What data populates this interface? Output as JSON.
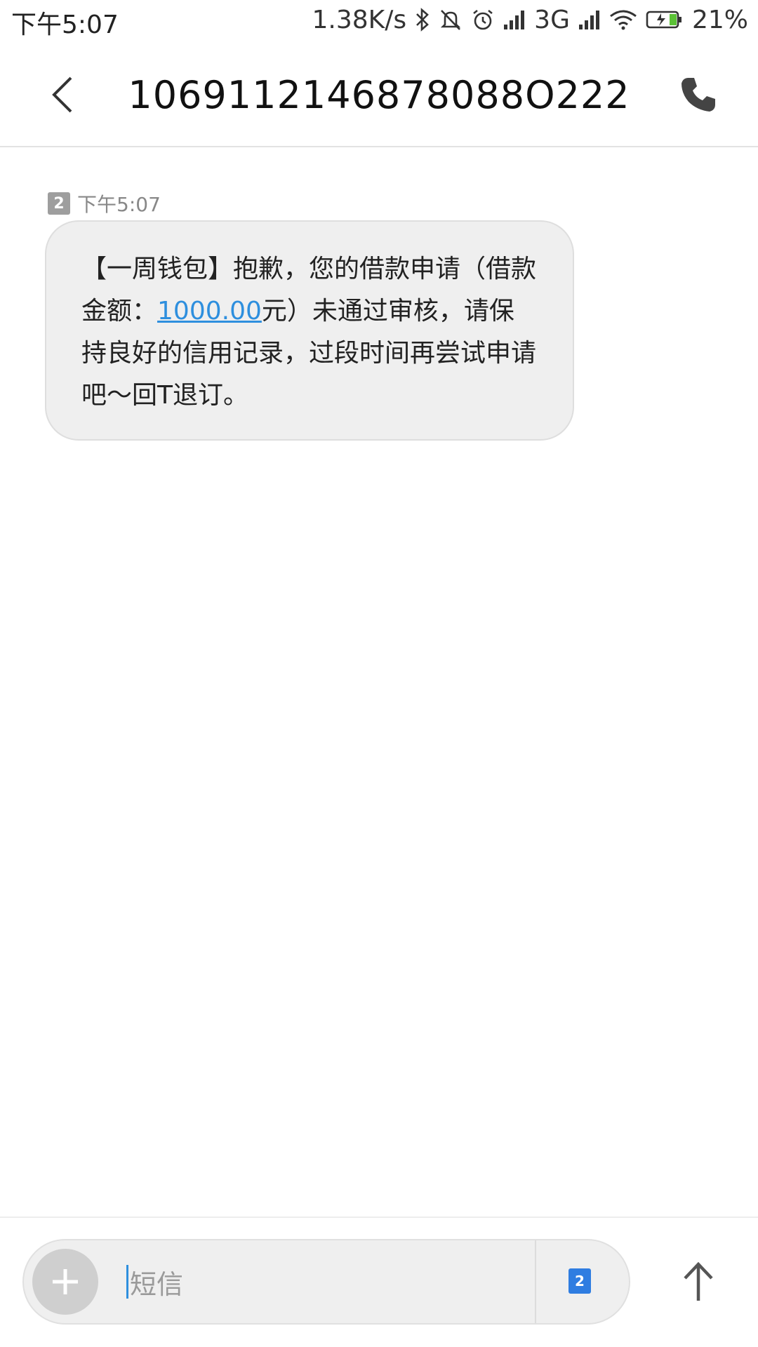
{
  "status_bar": {
    "time": "下午5:07",
    "net_speed": "1.38K/s",
    "network_type": "3G",
    "battery": "21%",
    "icons": [
      "bluetooth-icon",
      "mute-bell-icon",
      "alarm-icon",
      "signal-icon",
      "wifi-icon",
      "battery-charging-icon"
    ]
  },
  "header": {
    "title": "1069112146878088O222",
    "back_icon": "chevron-left-icon",
    "call_icon": "phone-icon"
  },
  "message": {
    "sim": "2",
    "time": "下午5:07",
    "text_before": "【一周钱包】抱歉，您的借款申请（借款金额：",
    "amount": "1000.00",
    "text_after": "元）未通过审核，请保持良好的信用记录，过段时间再尝试申请吧～回T退订。"
  },
  "composer": {
    "placeholder": "短信",
    "sim": "2",
    "plus_icon": "plus-icon",
    "send_icon": "arrow-up-icon"
  },
  "colors": {
    "link": "#2e8fde",
    "bubble": "#efefef",
    "sim_blue": "#2f7de1"
  }
}
